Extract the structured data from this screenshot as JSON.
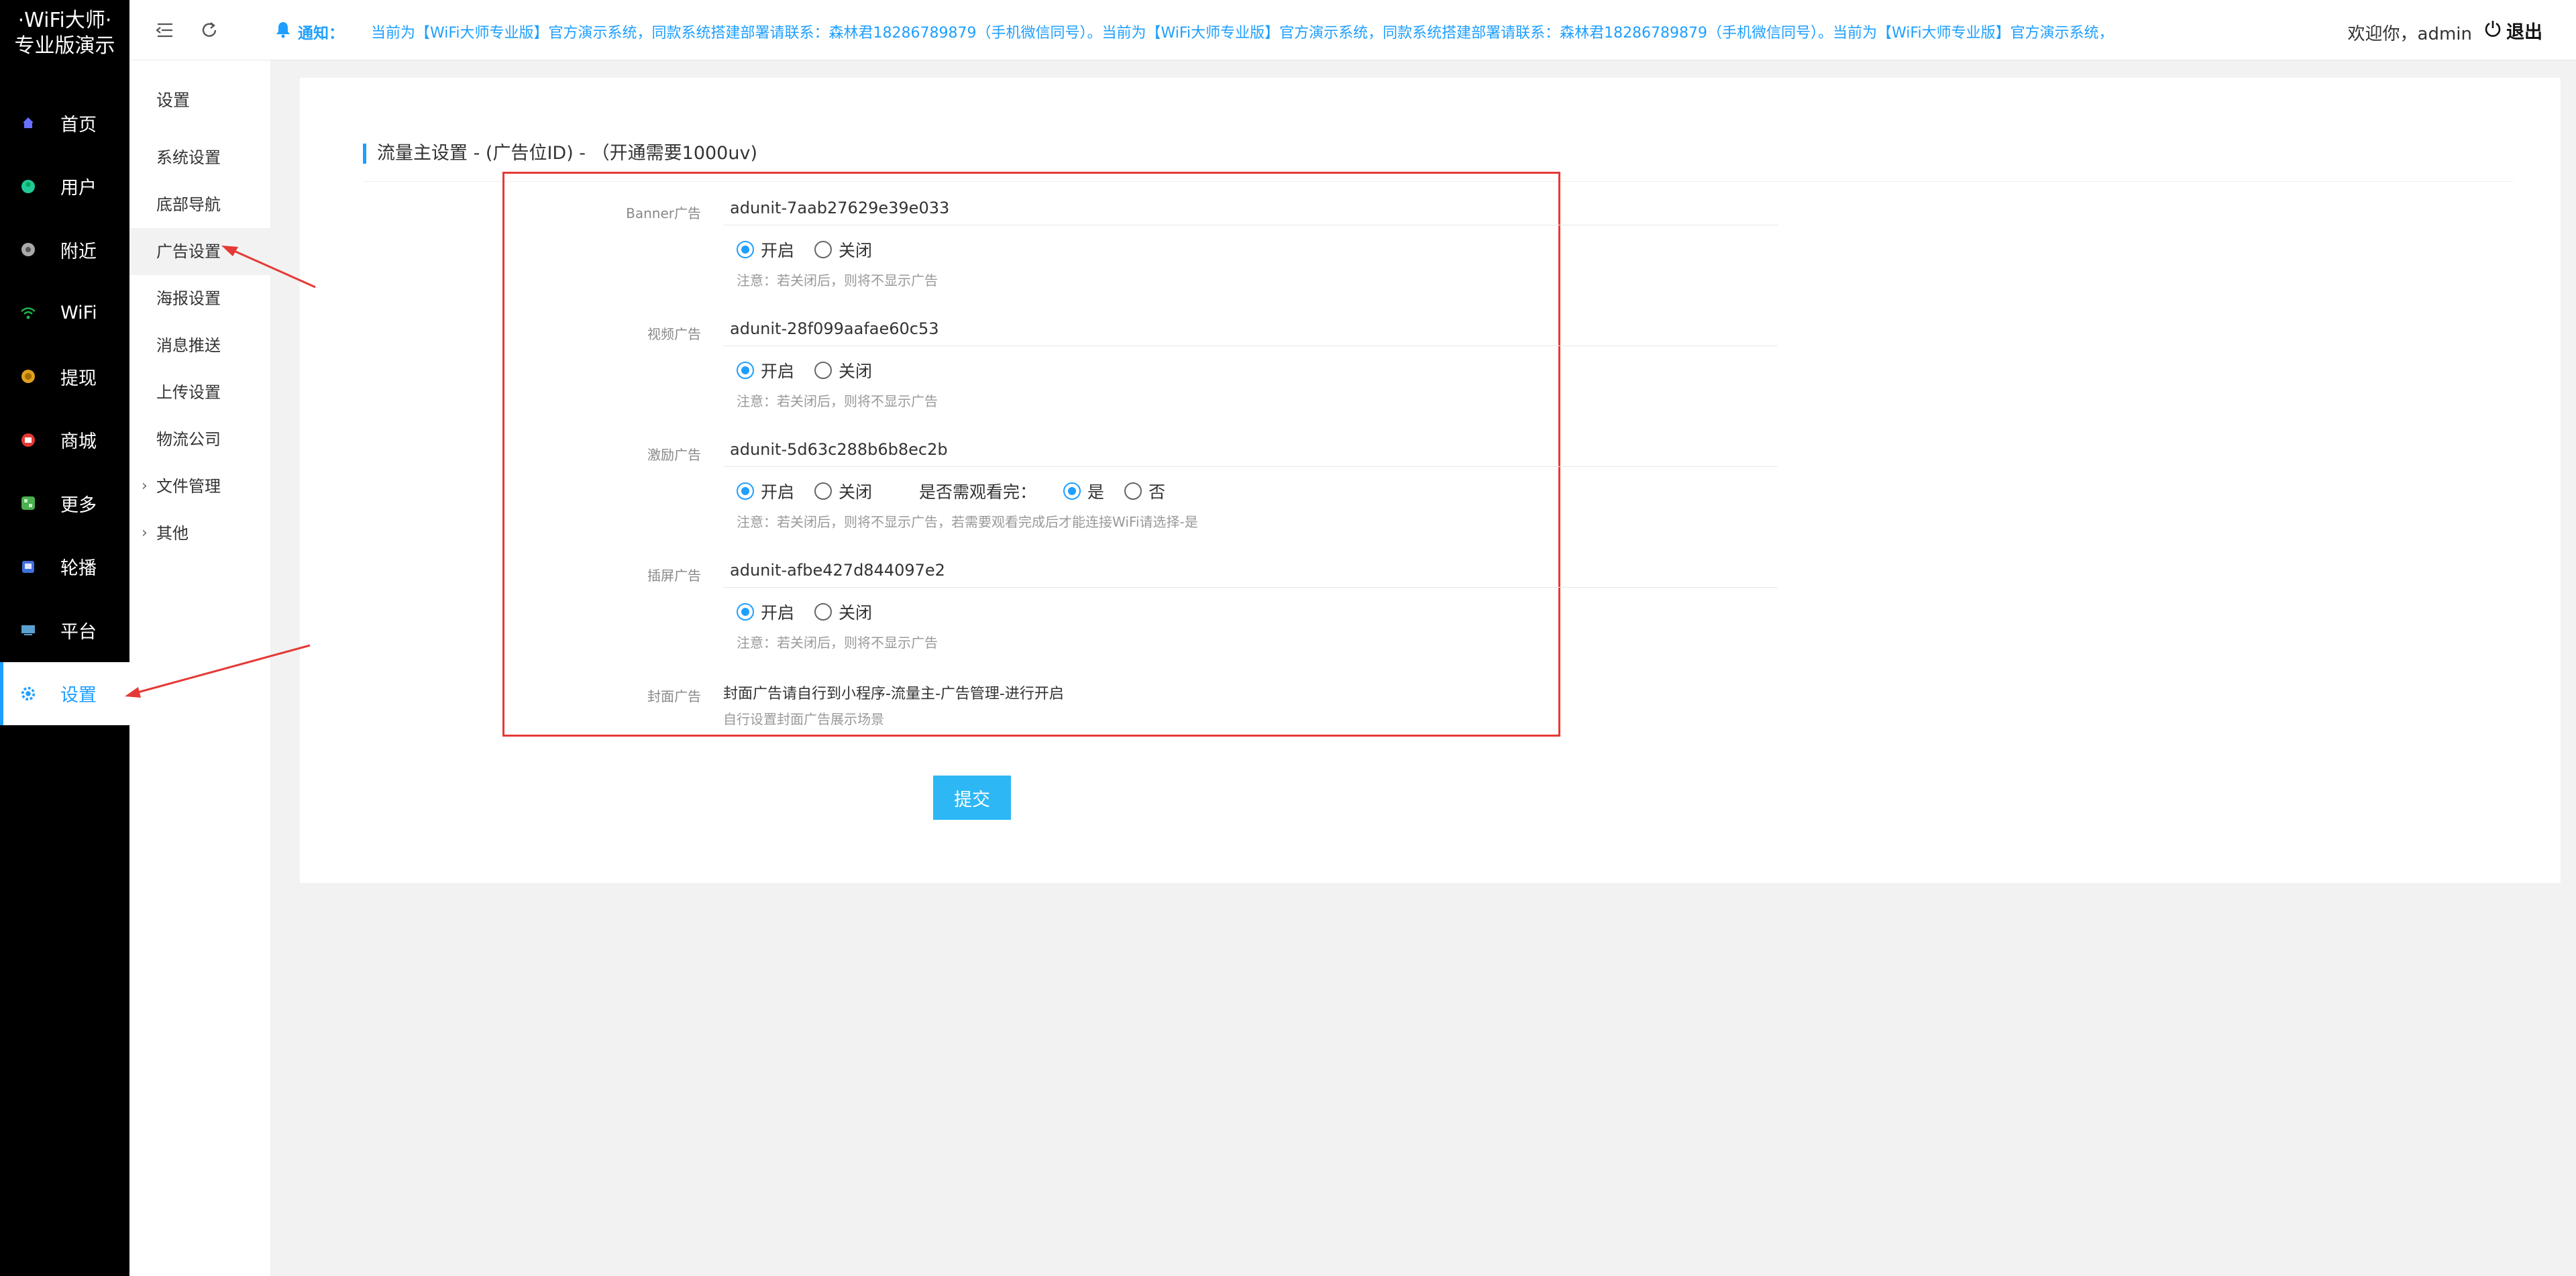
{
  "app": {
    "logo_line1": "·WiFi大师·",
    "logo_line2": "专业版演示"
  },
  "sidebar": {
    "items": [
      {
        "label": "首页",
        "icon": "home-icon",
        "color": "#6a6fff"
      },
      {
        "label": "用户",
        "icon": "user-icon",
        "color": "#20c997"
      },
      {
        "label": "附近",
        "icon": "location-icon",
        "color": "#aaaaaa"
      },
      {
        "label": "WiFi",
        "icon": "wifi-icon",
        "color": "#22b14c"
      },
      {
        "label": "提现",
        "icon": "withdraw-icon",
        "color": "#e0a020"
      },
      {
        "label": "商城",
        "icon": "shop-icon",
        "color": "#e53935"
      },
      {
        "label": "更多",
        "icon": "more-icon",
        "color": "#4caf50"
      },
      {
        "label": "轮播",
        "icon": "carousel-icon",
        "color": "#3f6fdc"
      },
      {
        "label": "平台",
        "icon": "platform-icon",
        "color": "#5aa0d0"
      },
      {
        "label": "设置",
        "icon": "settings-icon",
        "color": "#1e9fff",
        "active": true
      }
    ]
  },
  "header": {
    "notice_label": "通知：",
    "notice_text": "当前为【WiFi大师专业版】官方演示系统，同款系统搭建部署请联系：森林君18286789879（手机微信同号）。当前为【WiFi大师专业版】官方演示系统，同款系统搭建部署请联系：森林君18286789879（手机微信同号）。当前为【WiFi大师专业版】官方演示系统，",
    "welcome": "欢迎你，admin",
    "logout": "退出"
  },
  "submenu": {
    "title": "设置",
    "items": [
      "系统设置",
      "底部导航",
      "广告设置",
      "海报设置",
      "消息推送",
      "上传设置",
      "物流公司",
      "文件管理",
      "其他"
    ]
  },
  "form": {
    "title": "流量主设置 - (广告位ID) - （开通需要1000uv)",
    "banner": {
      "label": "Banner广告",
      "value": "adunit-7aab27629e39e033",
      "on": "开启",
      "off": "关闭",
      "tip": "注意：若关闭后，则将不显示广告"
    },
    "video": {
      "label": "视频广告",
      "value": "adunit-28f099aafae60c53",
      "on": "开启",
      "off": "关闭",
      "tip": "注意：若关闭后，则将不显示广告"
    },
    "reward": {
      "label": "激励广告",
      "value": "adunit-5d63c288b6b8ec2b",
      "on": "开启",
      "off": "关闭",
      "watch_label": "是否需观看完：",
      "yes": "是",
      "no": "否",
      "tip": "注意：若关闭后，则将不显示广告，若需要观看完成后才能连接WiFi请选择-是"
    },
    "interstitial": {
      "label": "插屏广告",
      "value": "adunit-afbe427d844097e2",
      "on": "开启",
      "off": "关闭",
      "tip": "注意：若关闭后，则将不显示广告"
    },
    "cover": {
      "label": "封面广告",
      "text": "封面广告请自行到小程序-流量主-广告管理-进行开启",
      "sub": "自行设置封面广告展示场景"
    },
    "submit": "提交"
  }
}
